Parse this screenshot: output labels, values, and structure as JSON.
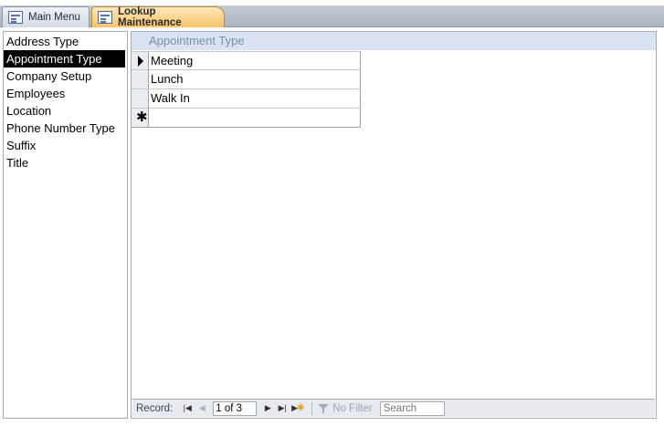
{
  "tabs": [
    {
      "label": "Main Menu",
      "icon": "form-icon",
      "active": false
    },
    {
      "label": "Lookup Maintenance",
      "icon": "form-icon",
      "active": true
    }
  ],
  "lookup_list": {
    "items": [
      "Address Type",
      "Appointment Type",
      "Company Setup",
      "Employees",
      "Location",
      "Phone Number Type",
      "Suffix",
      "Title"
    ],
    "selected": "Appointment Type"
  },
  "datasheet": {
    "column_header": "Appointment Type",
    "rows": [
      "Meeting",
      "Lunch",
      "Walk In"
    ],
    "current_row_icon": "current-record-arrow-icon",
    "new_row_icon": "new-record-asterisk-icon"
  },
  "navigation": {
    "record_label": "Record:",
    "record_position": "1 of 3",
    "filter_label": "No Filter",
    "search_placeholder": "Search"
  },
  "colors": {
    "active_tab": "#f9c46b",
    "header_bg": "#d9e3f2",
    "header_text": "#7a8fb0",
    "selection": "#000000"
  }
}
